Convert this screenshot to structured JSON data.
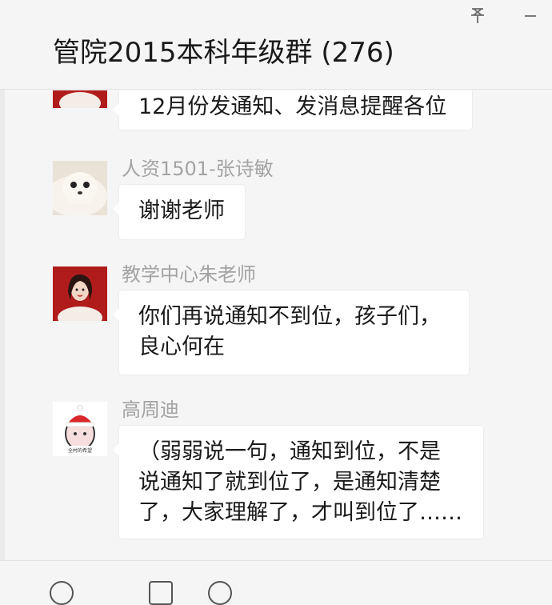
{
  "window": {
    "title": "管院2015本科年级群 (276)",
    "pin_icon": "pin-icon",
    "minimize_icon": "minimize-icon"
  },
  "messages": [
    {
      "sender": "",
      "avatar": "red-portrait-avatar",
      "lines": [
        "12月份发通知、发消息提醒各位"
      ]
    },
    {
      "sender": "人资1501-张诗敏",
      "avatar": "seal-avatar",
      "lines": [
        "谢谢老师"
      ]
    },
    {
      "sender": "教学中心朱老师",
      "avatar": "red-portrait-avatar",
      "lines": [
        "你们再说通知不到位，孩子们，",
        "良心何在"
      ]
    },
    {
      "sender": "高周迪",
      "avatar": "santa-hat-cartoon-avatar",
      "avatar_text": "全村的希望",
      "lines": [
        "（弱弱说一句，通知到位，不是",
        "说通知了就到位了，是通知清楚",
        "了，大家理解了，才叫到位了……"
      ]
    }
  ],
  "colors": {
    "background": "#f5f5f5",
    "bubble": "#ffffff",
    "sender_text": "#a3a3a3",
    "message_text": "#1a1a1a"
  }
}
